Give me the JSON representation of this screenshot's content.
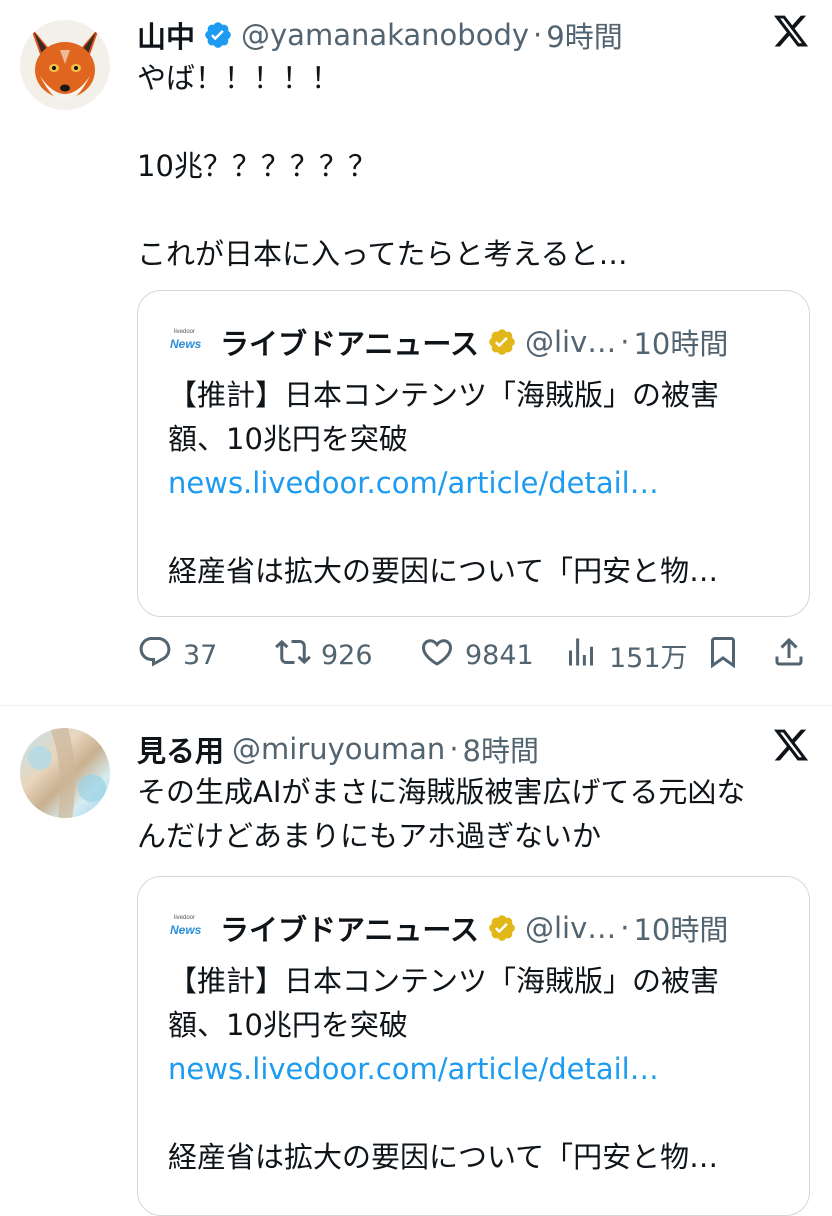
{
  "tweets": [
    {
      "name": "山中",
      "handle": "@yamanakanobody",
      "time": "9時間",
      "verified": true,
      "text": "やば！！！！！\n\n10兆？？？？？？\n\nこれが日本に入ってたらと考えると…",
      "quote": {
        "logo_top": "livedoor",
        "logo_bottom": "News",
        "name": "ライブドアニュース",
        "handle": "@liv…",
        "time": "10時間",
        "line1": "【推計】日本コンテンツ「海賊版」の被害",
        "line2": "額、10兆円を突破",
        "link": "news.livedoor.com/article/detail…",
        "line3": "経産省は拡大の要因について「円安と物…"
      },
      "actions": {
        "replies": "37",
        "retweets": "926",
        "likes": "9841",
        "views": "151万"
      }
    },
    {
      "name": "見る用",
      "handle": "@miruyouman",
      "time": "8時間",
      "verified": false,
      "text": "その生成AIがまさに海賊版被害広げてる元凶な\nんだけどあまりにもアホ過ぎないか",
      "quote": {
        "logo_top": "livedoor",
        "logo_bottom": "News",
        "name": "ライブドアニュース",
        "handle": "@liv…",
        "time": "10時間",
        "line1": "【推計】日本コンテンツ「海賊版」の被害",
        "line2": "額、10兆円を突破",
        "link": "news.livedoor.com/article/detail…",
        "line3": "経産省は拡大の要因について「円安と物…"
      }
    }
  ],
  "colors": {
    "verified_blue": "#1d9bf0",
    "verified_gold": "#e2b719",
    "link": "#1d9bf0",
    "secondary_text": "#536471"
  },
  "icons": [
    "x-logo-icon",
    "verified-badge-icon",
    "gold-verified-badge-icon",
    "reply-icon",
    "retweet-icon",
    "like-icon",
    "views-icon",
    "bookmark-icon",
    "share-icon"
  ]
}
